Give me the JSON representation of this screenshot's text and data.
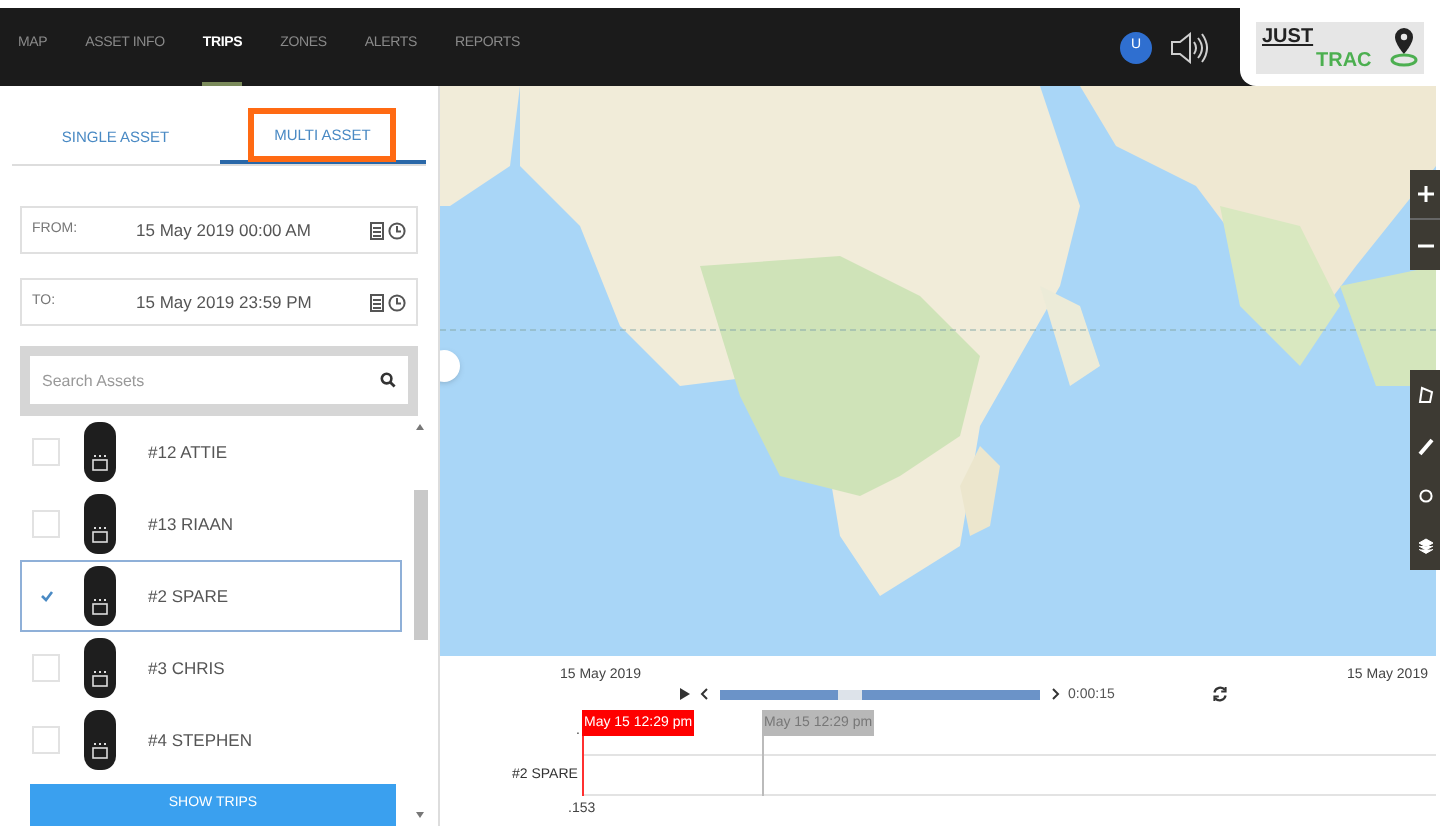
{
  "nav": [
    {
      "label": "MAP",
      "selected": false
    },
    {
      "label": "ASSET INFO",
      "selected": false
    },
    {
      "label": "TRIPS",
      "selected": true
    },
    {
      "label": "ZONES",
      "selected": false
    },
    {
      "label": "ALERTS",
      "selected": false
    },
    {
      "label": "REPORTS",
      "selected": false
    }
  ],
  "user_badge": "U",
  "logo": {
    "top": "JUST",
    "bottom": "TRAC"
  },
  "tabs": [
    {
      "label": "SINGLE ASSET",
      "selected": false,
      "highlighted": false
    },
    {
      "label": "MULTI ASSET",
      "selected": true,
      "highlighted": true
    }
  ],
  "date_fields": [
    {
      "label": "FROM:",
      "value": "15 May 2019 00:00 AM"
    },
    {
      "label": "TO:",
      "value": "15 May 2019 23:59 PM"
    }
  ],
  "search": {
    "placeholder": "Search Assets"
  },
  "assets": [
    {
      "name": "#12 ATTIE",
      "checked": false,
      "selected": false
    },
    {
      "name": "#13 RIAAN",
      "checked": false,
      "selected": false
    },
    {
      "name": "#2 SPARE",
      "checked": true,
      "selected": true
    },
    {
      "name": "#3 CHRIS",
      "checked": false,
      "selected": false
    },
    {
      "name": "#4 STEPHEN",
      "checked": false,
      "selected": false
    }
  ],
  "show_trips_button": "SHOW TRIPS",
  "timeline": {
    "start_date": "15 May 2019",
    "end_date": "15 May 2019",
    "level": 0.37,
    "elapsed": "0:00:15",
    "start_marker": "May 15 12:29 pm",
    "end_marker": "May 15 12:29 pm",
    "row_top_label": ".",
    "row_label": "#2 SPARE",
    "row_bottom_label": ".153"
  }
}
